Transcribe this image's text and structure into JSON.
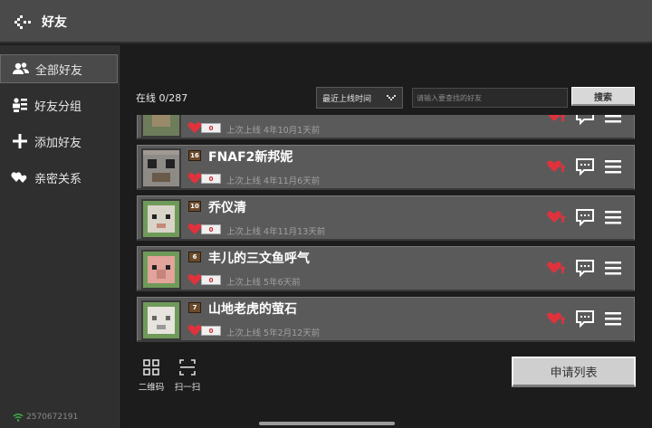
{
  "header": {
    "title": "好友",
    "back_icon": "back-arrow-icon"
  },
  "sidebar": {
    "items": [
      {
        "label": "全部好友",
        "icon": "friends-icon",
        "active": true
      },
      {
        "label": "好友分组",
        "icon": "group-icon",
        "active": false
      },
      {
        "label": "添加好友",
        "icon": "plus-icon",
        "active": false
      },
      {
        "label": "亲密关系",
        "icon": "heart-link-icon",
        "active": false
      }
    ],
    "user_id": "2570672191"
  },
  "toolbar": {
    "online": "在线 0/287",
    "sort_value": "最近上线时间",
    "search_placeholder": "请输入要查找的好友",
    "search_label": "搜索"
  },
  "friends": [
    {
      "name": "",
      "level": "",
      "popularity": "0",
      "last_seen": "上次上线 4年10月1天前",
      "avatar_color": "#7a8a6a"
    },
    {
      "name": "FNAF2新邦妮",
      "level": "16",
      "popularity": "0",
      "last_seen": "上次上线 4年11月6天前",
      "avatar_color": "#8a9088"
    },
    {
      "name": "乔仪清",
      "level": "10",
      "popularity": "0",
      "last_seen": "上次上线 4年11月13天前",
      "avatar_color": "#6f9a5a"
    },
    {
      "name": "丰儿的三文鱼呼气",
      "level": "6",
      "popularity": "0",
      "last_seen": "上次上线 5年6天前",
      "avatar_color": "#6f9a5a"
    },
    {
      "name": "山地老虎的萤石",
      "level": "7",
      "popularity": "0",
      "last_seen": "上次上线 5年2月12天前",
      "avatar_color": "#6f9a5a"
    }
  ],
  "bottom": {
    "qr_label": "二维码",
    "scan_label": "扫一扫",
    "request_label": "申请列表"
  },
  "colors": {
    "accent_heart": "#e0323c",
    "header_bg": "#4a4a4a",
    "row_bg": "#5a5a5a"
  }
}
